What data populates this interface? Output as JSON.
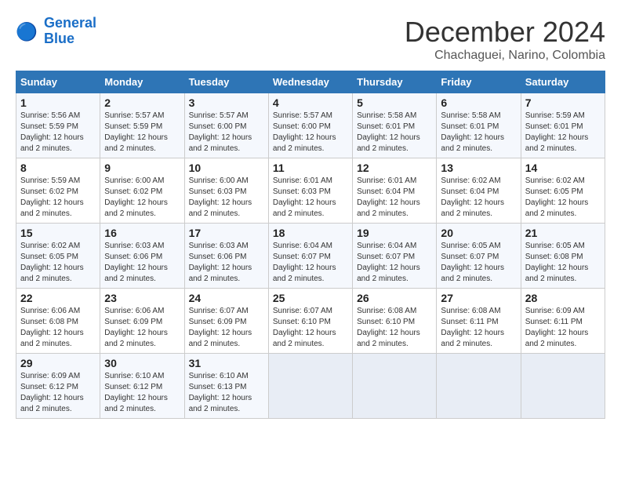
{
  "logo": {
    "text_general": "General",
    "text_blue": "Blue"
  },
  "header": {
    "month": "December 2024",
    "location": "Chachaguei, Narino, Colombia"
  },
  "weekdays": [
    "Sunday",
    "Monday",
    "Tuesday",
    "Wednesday",
    "Thursday",
    "Friday",
    "Saturday"
  ],
  "weeks": [
    [
      {
        "day": "1",
        "sunrise": "5:56 AM",
        "sunset": "5:59 PM",
        "daylight": "12 hours and 2 minutes."
      },
      {
        "day": "2",
        "sunrise": "5:57 AM",
        "sunset": "5:59 PM",
        "daylight": "12 hours and 2 minutes."
      },
      {
        "day": "3",
        "sunrise": "5:57 AM",
        "sunset": "6:00 PM",
        "daylight": "12 hours and 2 minutes."
      },
      {
        "day": "4",
        "sunrise": "5:57 AM",
        "sunset": "6:00 PM",
        "daylight": "12 hours and 2 minutes."
      },
      {
        "day": "5",
        "sunrise": "5:58 AM",
        "sunset": "6:01 PM",
        "daylight": "12 hours and 2 minutes."
      },
      {
        "day": "6",
        "sunrise": "5:58 AM",
        "sunset": "6:01 PM",
        "daylight": "12 hours and 2 minutes."
      },
      {
        "day": "7",
        "sunrise": "5:59 AM",
        "sunset": "6:01 PM",
        "daylight": "12 hours and 2 minutes."
      }
    ],
    [
      {
        "day": "8",
        "sunrise": "5:59 AM",
        "sunset": "6:02 PM",
        "daylight": "12 hours and 2 minutes."
      },
      {
        "day": "9",
        "sunrise": "6:00 AM",
        "sunset": "6:02 PM",
        "daylight": "12 hours and 2 minutes."
      },
      {
        "day": "10",
        "sunrise": "6:00 AM",
        "sunset": "6:03 PM",
        "daylight": "12 hours and 2 minutes."
      },
      {
        "day": "11",
        "sunrise": "6:01 AM",
        "sunset": "6:03 PM",
        "daylight": "12 hours and 2 minutes."
      },
      {
        "day": "12",
        "sunrise": "6:01 AM",
        "sunset": "6:04 PM",
        "daylight": "12 hours and 2 minutes."
      },
      {
        "day": "13",
        "sunrise": "6:02 AM",
        "sunset": "6:04 PM",
        "daylight": "12 hours and 2 minutes."
      },
      {
        "day": "14",
        "sunrise": "6:02 AM",
        "sunset": "6:05 PM",
        "daylight": "12 hours and 2 minutes."
      }
    ],
    [
      {
        "day": "15",
        "sunrise": "6:02 AM",
        "sunset": "6:05 PM",
        "daylight": "12 hours and 2 minutes."
      },
      {
        "day": "16",
        "sunrise": "6:03 AM",
        "sunset": "6:06 PM",
        "daylight": "12 hours and 2 minutes."
      },
      {
        "day": "17",
        "sunrise": "6:03 AM",
        "sunset": "6:06 PM",
        "daylight": "12 hours and 2 minutes."
      },
      {
        "day": "18",
        "sunrise": "6:04 AM",
        "sunset": "6:07 PM",
        "daylight": "12 hours and 2 minutes."
      },
      {
        "day": "19",
        "sunrise": "6:04 AM",
        "sunset": "6:07 PM",
        "daylight": "12 hours and 2 minutes."
      },
      {
        "day": "20",
        "sunrise": "6:05 AM",
        "sunset": "6:07 PM",
        "daylight": "12 hours and 2 minutes."
      },
      {
        "day": "21",
        "sunrise": "6:05 AM",
        "sunset": "6:08 PM",
        "daylight": "12 hours and 2 minutes."
      }
    ],
    [
      {
        "day": "22",
        "sunrise": "6:06 AM",
        "sunset": "6:08 PM",
        "daylight": "12 hours and 2 minutes."
      },
      {
        "day": "23",
        "sunrise": "6:06 AM",
        "sunset": "6:09 PM",
        "daylight": "12 hours and 2 minutes."
      },
      {
        "day": "24",
        "sunrise": "6:07 AM",
        "sunset": "6:09 PM",
        "daylight": "12 hours and 2 minutes."
      },
      {
        "day": "25",
        "sunrise": "6:07 AM",
        "sunset": "6:10 PM",
        "daylight": "12 hours and 2 minutes."
      },
      {
        "day": "26",
        "sunrise": "6:08 AM",
        "sunset": "6:10 PM",
        "daylight": "12 hours and 2 minutes."
      },
      {
        "day": "27",
        "sunrise": "6:08 AM",
        "sunset": "6:11 PM",
        "daylight": "12 hours and 2 minutes."
      },
      {
        "day": "28",
        "sunrise": "6:09 AM",
        "sunset": "6:11 PM",
        "daylight": "12 hours and 2 minutes."
      }
    ],
    [
      {
        "day": "29",
        "sunrise": "6:09 AM",
        "sunset": "6:12 PM",
        "daylight": "12 hours and 2 minutes."
      },
      {
        "day": "30",
        "sunrise": "6:10 AM",
        "sunset": "6:12 PM",
        "daylight": "12 hours and 2 minutes."
      },
      {
        "day": "31",
        "sunrise": "6:10 AM",
        "sunset": "6:13 PM",
        "daylight": "12 hours and 2 minutes."
      },
      null,
      null,
      null,
      null
    ]
  ],
  "labels": {
    "sunrise_prefix": "Sunrise: ",
    "sunset_prefix": "Sunset: ",
    "daylight_prefix": "Daylight: "
  }
}
